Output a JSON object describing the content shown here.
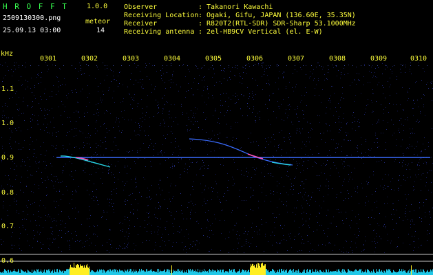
{
  "header": {
    "app_title": "H R O F F T",
    "version": "1.0.0",
    "filename": "2509130300.png",
    "datetime": "25.09.13 03:00",
    "meteor_label": "meteor",
    "meteor_count": "14"
  },
  "info": {
    "observer_label": "Observer",
    "observer_value": ": Takanori Kawachi",
    "location_label": "Receiving Location",
    "location_value": ": Ogaki, Gifu, JAPAN (136.60E, 35.35N)",
    "receiver_label": "Receiver",
    "receiver_value": ": R820T2(RTL-SDR) SDR-Sharp 53.1000MHz",
    "antenna_label": "Receiving antenna",
    "antenna_value": ": 2el-HB9CV Vertical (el. E-W)"
  },
  "axis": {
    "unit": "kHz",
    "y_ticks": [
      "1.1",
      "1.0",
      "0.9",
      "0.8",
      "0.7",
      "0.6"
    ],
    "x_ticks": [
      "0301",
      "0302",
      "0303",
      "0304",
      "0305",
      "0306",
      "0307",
      "0308",
      "0309",
      "0310"
    ]
  },
  "colors": {
    "background": "#000000",
    "label_green": "#37ff4f",
    "label_yellow": "#ffff3c",
    "noise_blue": "#1a1f66",
    "carrier_line": "#3a6cff",
    "echo_cyan": "#27d6e6",
    "echo_magenta": "#ff4fb0",
    "spectrum_cyan": "#1fc8e8",
    "spectrum_yellow": "#ffee22"
  }
}
